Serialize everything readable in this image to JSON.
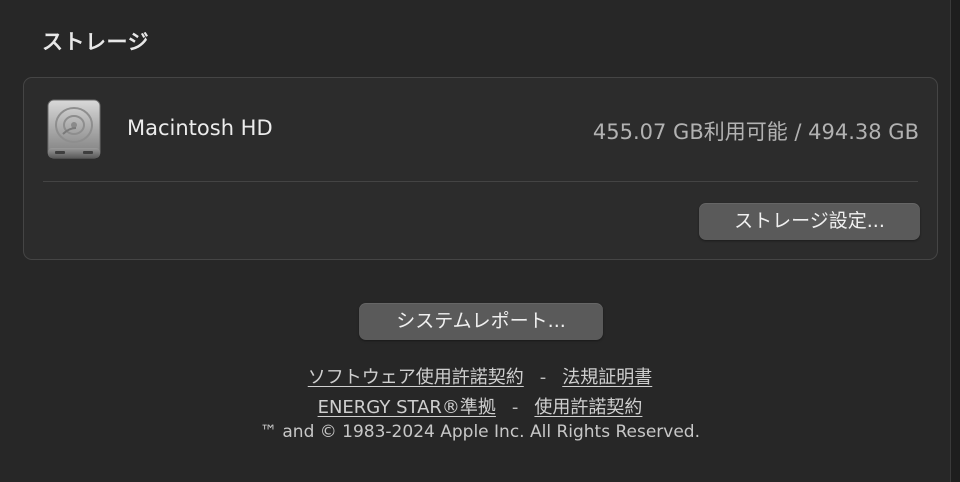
{
  "storage": {
    "title": "ストレージ",
    "disk": {
      "icon": "hard-drive-icon",
      "name": "Macintosh HD",
      "capacity": "455.07 GB利用可能 / 494.38 GB"
    },
    "settings_button": "ストレージ設定..."
  },
  "system_report_button": "システムレポート...",
  "footer": {
    "software_license": "ソフトウェア使用許諾契約",
    "separator": "-",
    "regulatory": "法規証明書",
    "energy_star": "ENERGY STAR®準拠",
    "license": "使用許諾契約",
    "copyright": "™ and © 1983-2024 Apple Inc. All Rights Reserved."
  },
  "colors": {
    "background": "#272727",
    "card": "#2c2c2c",
    "button": "#5a5a5a"
  }
}
